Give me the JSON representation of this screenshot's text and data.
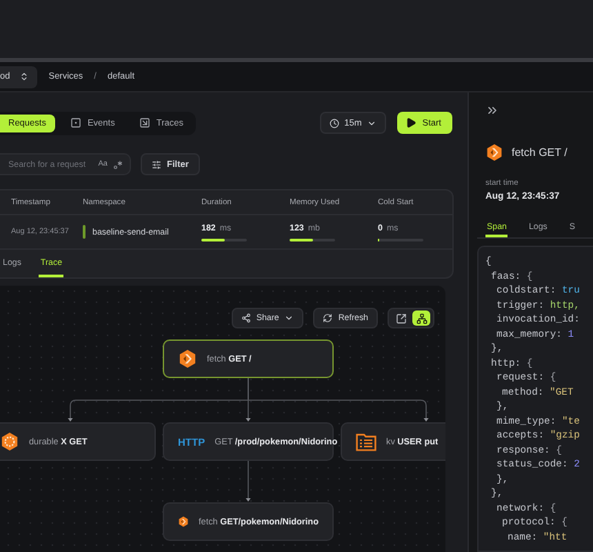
{
  "breadcrumb": {
    "project": "od",
    "items": [
      "Services",
      "default"
    ],
    "separator": "/"
  },
  "view_tabs": [
    {
      "label": "Requests",
      "kind": "requests",
      "selected": true
    },
    {
      "label": "Events",
      "kind": "events",
      "selected": false
    },
    {
      "label": "Traces",
      "kind": "traces",
      "selected": false
    }
  ],
  "time_range": "15m",
  "start_button": "Start",
  "search": {
    "placeholder": "Search for a request",
    "case_toggle": "Aa"
  },
  "filter_button": "Filter",
  "table": {
    "columns": [
      "Timestamp",
      "Namespace",
      "Duration",
      "Memory Used",
      "Cold Start"
    ],
    "rows": [
      {
        "timestamp": "Aug 12, 23:45:37",
        "namespace": "baseline-send-email",
        "metrics": [
          {
            "value": "182",
            "unit": "ms",
            "level": 0.5
          },
          {
            "value": "123",
            "unit": "mb",
            "level": 0.5
          },
          {
            "value": "0",
            "unit": "ms",
            "level": 0
          }
        ]
      }
    ]
  },
  "detail_tabs": [
    {
      "label": "Logs",
      "selected": false
    },
    {
      "label": "Trace",
      "selected": true
    }
  ],
  "trace": {
    "share_button": "Share",
    "refresh_button": "Refresh",
    "view_toggles": [
      {
        "kind": "flat",
        "selected": false
      },
      {
        "kind": "tree",
        "selected": true
      }
    ],
    "root": {
      "kind": "fetch",
      "label": "fetch **GET /**",
      "selected": true,
      "children": [
        {
          "kind": "durable",
          "label": "durable **X GET**",
          "selected": false
        },
        {
          "kind": "http",
          "badge": "HTTP",
          "label": "GET **/prod/pokemon/Nidorino**",
          "selected": false,
          "children": [
            {
              "kind": "fetch",
              "label": "fetch **GET/pokemon/Nidorino**",
              "selected": false
            }
          ]
        },
        {
          "kind": "kv",
          "label": "kv **USER put**",
          "selected": false
        }
      ]
    }
  },
  "span_panel": {
    "title": "fetch GET /",
    "start_label": "start time",
    "start_value": "Aug 12, 23:45:37",
    "tabs": [
      {
        "label": "Span",
        "selected": true
      },
      {
        "label": "Logs",
        "selected": false
      },
      {
        "label": "S",
        "selected": false
      }
    ],
    "code_lines": [
      {
        "text": "{",
        "children": [
          {
            "text": "faas:",
            "value": "{",
            "kind": "punct",
            "children": [
              {
                "text": "coldstart:",
                "value": "tru",
                "kind": "bool"
              },
              {
                "text": "trigger:",
                "value": "http,",
                "kind": "ident"
              },
              {
                "text": "invocation_id:"
              },
              {
                "text": "max_memory:",
                "value": "1",
                "kind": "number"
              }
            ]
          },
          {
            "text": "},"
          },
          {
            "text": "http:",
            "value": "{",
            "kind": "punct",
            "children": [
              {
                "text": "request:",
                "value": "{",
                "kind": "punct",
                "children": [
                  {
                    "text": "method:",
                    "value": "\"GET",
                    "kind": "string"
                  }
                ]
              },
              {
                "text": "},"
              },
              {
                "text": "mime_type:",
                "value": "\"te",
                "kind": "string"
              },
              {
                "text": "accepts:",
                "value": "\"gzip",
                "kind": "string"
              },
              {
                "text": "response:",
                "value": "{",
                "kind": "punct"
              },
              {
                "text": "status_code:",
                "value": "2",
                "kind": "number"
              },
              {
                "text": "},"
              }
            ]
          },
          {
            "text": "},",
            "children": [
              {
                "text": "network:",
                "value": "{",
                "kind": "punct",
                "children": [
                  {
                    "text": "protocol:",
                    "value": "{",
                    "kind": "punct",
                    "children": [
                      {
                        "text": "name:",
                        "value": "\"htt",
                        "kind": "string"
                      }
                    ]
                  }
                ]
              }
            ]
          }
        ]
      }
    ]
  }
}
